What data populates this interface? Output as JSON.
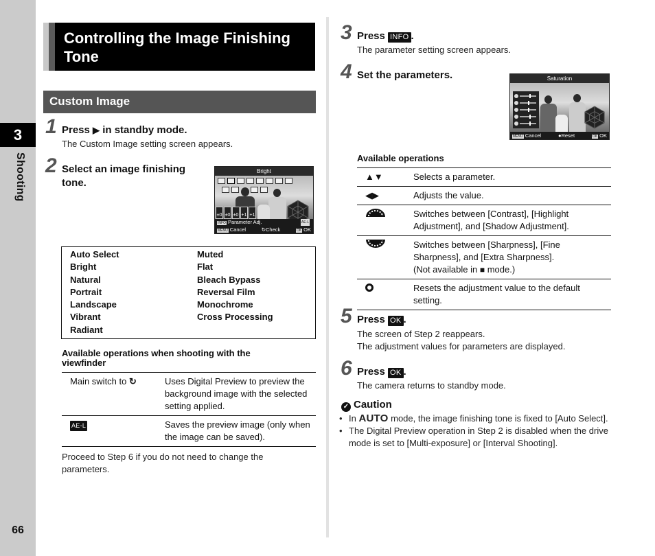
{
  "sidebar": {
    "chapter_number": "3",
    "chapter_label": "Shooting",
    "page_number": "66"
  },
  "header": {
    "title": "Controlling the Image Finishing Tone",
    "section": "Custom Image"
  },
  "steps": [
    {
      "number": "1",
      "title_pre": "Press",
      "title_icon": "▶",
      "title_post": "in standby mode.",
      "description": "The Custom Image setting screen appears."
    },
    {
      "number": "2",
      "title": "Select an image finishing tone."
    },
    {
      "number": "3",
      "title_pre": "Press",
      "title_key": "INFO",
      "title_post": ".",
      "description": "The parameter setting screen appears."
    },
    {
      "number": "4",
      "title": "Set the parameters."
    },
    {
      "number": "5",
      "title_pre": "Press",
      "title_key": "OK",
      "title_post": ".",
      "description_lines": [
        "The screen of Step 2 reappears.",
        "The adjustment values for parameters are displayed."
      ]
    },
    {
      "number": "6",
      "title_pre": "Press",
      "title_key": "OK",
      "title_post": ".",
      "description": "The camera returns to standby mode."
    }
  ],
  "screen_step2": {
    "title": "Bright",
    "values": [
      "±0",
      "±0",
      "±0",
      "+1",
      "+1"
    ],
    "row1_key": "INFO",
    "row1_label": "Parameter Adj.",
    "row1_right": "AE-L",
    "footer": {
      "left_key": "MENU",
      "left": "Cancel",
      "center": "Check",
      "right_key": "OK",
      "right": "OK"
    }
  },
  "screen_step4": {
    "title": "Saturation",
    "footer": {
      "left_key": "MENU",
      "left": "Cancel",
      "center": "Reset",
      "right_key": "OK",
      "right": "OK"
    }
  },
  "tones": {
    "left": [
      "Auto Select",
      "Bright",
      "Natural",
      "Portrait",
      "Landscape",
      "Vibrant",
      "Radiant"
    ],
    "right": [
      "Muted",
      "Flat",
      "Bleach Bypass",
      "Reversal Film",
      "Monochrome",
      "Cross Processing"
    ]
  },
  "viewfinder_ops": {
    "heading": "Available operations when shooting with the viewfinder",
    "rows": [
      {
        "control": "Main switch to",
        "control_icon": "preview-icon",
        "description": "Uses Digital Preview to preview the background image with the selected setting applied."
      },
      {
        "control_key": "AE-L",
        "description": "Saves the preview image (only when the image can be saved)."
      }
    ]
  },
  "proceed_note": "Proceed to Step 6 if you do not need to change the parameters.",
  "available_ops": {
    "heading": "Available operations",
    "rows": [
      {
        "icon": "▲▼",
        "description": "Selects a parameter."
      },
      {
        "icon": "◀▶",
        "description": "Adjusts the value."
      },
      {
        "icon": "front-dial-icon",
        "description": "Switches between [Contrast], [Highlight Adjustment], and [Shadow Adjustment]."
      },
      {
        "icon": "rear-dial-icon",
        "description_pre": "Switches between [Sharpness], [Fine Sharpness], and [Extra Sharpness].",
        "description_post_a": "(Not available in",
        "description_post_b": "mode.)"
      },
      {
        "icon": "circle-icon",
        "description": "Resets the adjustment value to the default setting."
      }
    ]
  },
  "caution": {
    "heading": "Caution",
    "bullets": [
      {
        "pre": "In",
        "bold": "AUTO",
        "post": "mode, the image finishing tone is fixed to [Auto Select]."
      },
      {
        "text": "The Digital Preview operation in Step 2 is disabled when the drive mode is set to [Multi-exposure] or [Interval Shooting]."
      }
    ]
  }
}
